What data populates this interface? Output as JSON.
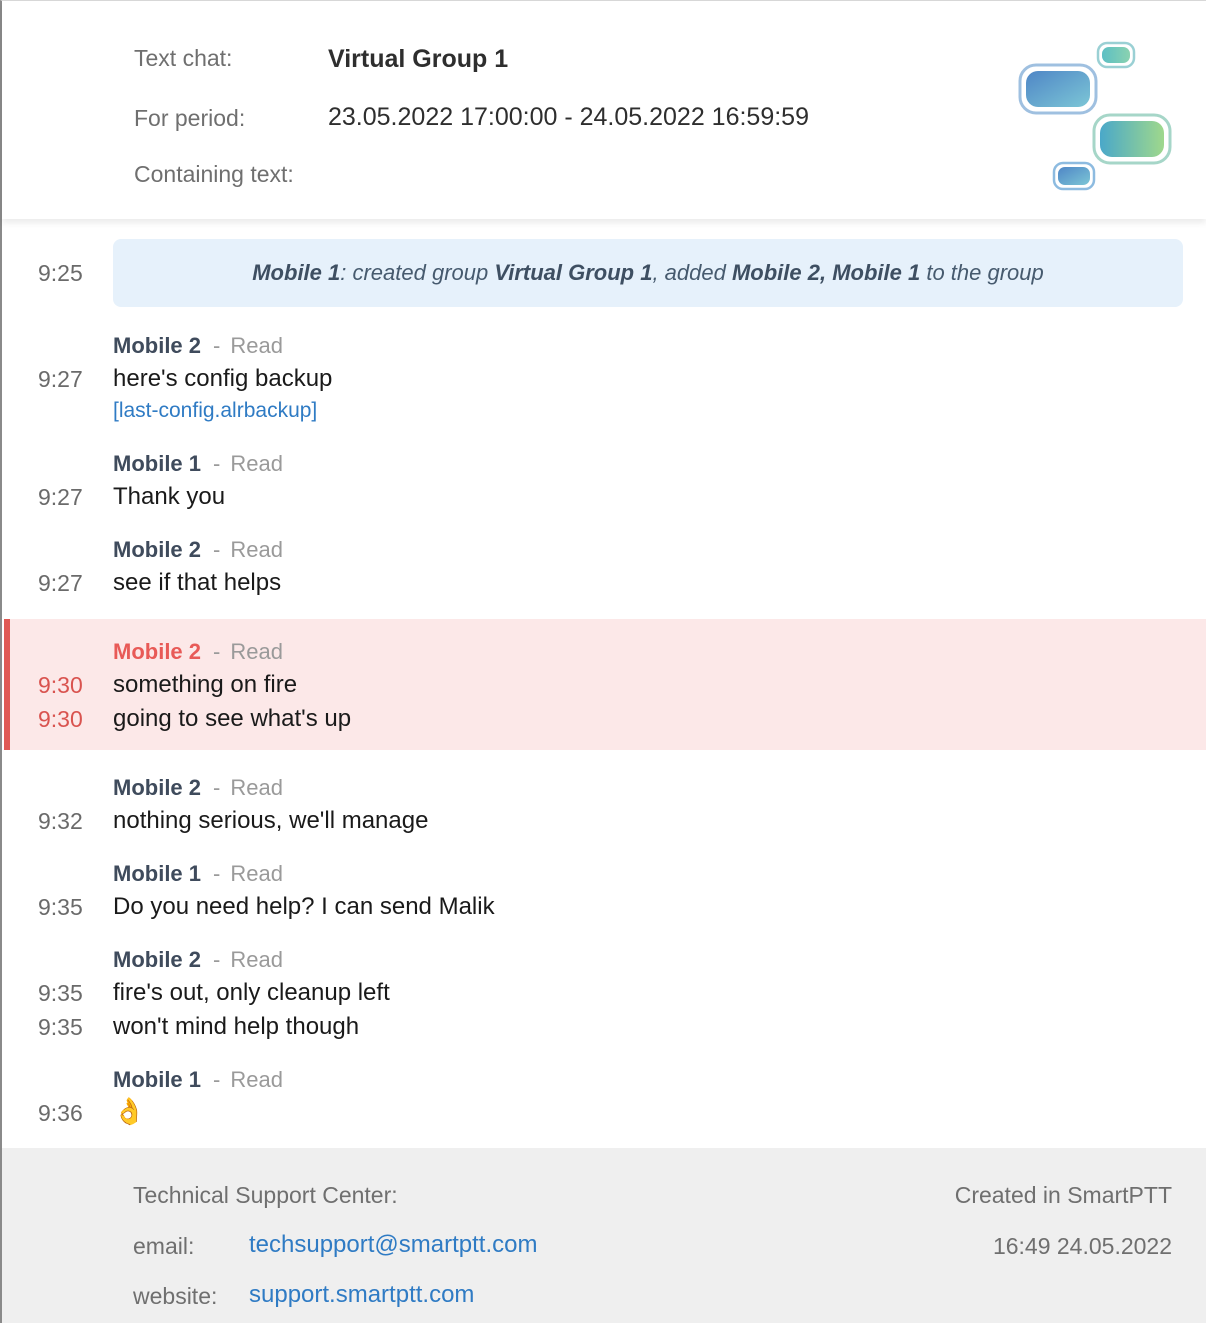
{
  "header": {
    "text_chat_label": "Text chat:",
    "text_chat_value": "Virtual Group 1",
    "period_label": "For period:",
    "period_value": "23.05.2022 17:00:00 - 24.05.2022 16:59:59",
    "containing_label": "Containing text:",
    "containing_value": ""
  },
  "system_message": {
    "time": "9:25",
    "actor": "Mobile 1",
    "text1": ": created group ",
    "group": "Virtual Group 1",
    "text2": ", added ",
    "members": "Mobile 2, Mobile 1",
    "text3": " to the group"
  },
  "messages": [
    {
      "sender": "Mobile 2",
      "status": "Read",
      "separator": "-",
      "lines": [
        {
          "time": "9:27",
          "text": "here's config backup"
        }
      ],
      "attachment": "[last-config.alrbackup]"
    },
    {
      "sender": "Mobile 1",
      "status": "Read",
      "separator": "-",
      "lines": [
        {
          "time": "9:27",
          "text": "Thank you"
        }
      ]
    },
    {
      "sender": "Mobile 2",
      "status": "Read",
      "separator": "-",
      "lines": [
        {
          "time": "9:27",
          "text": "see if that helps"
        }
      ]
    },
    {
      "sender": "Mobile 2",
      "status": "Read",
      "separator": "-",
      "alert": true,
      "lines": [
        {
          "time": "9:30",
          "text": "something on fire"
        },
        {
          "time": "9:30",
          "text": "going to see what's up"
        }
      ]
    },
    {
      "sender": "Mobile 2",
      "status": "Read",
      "separator": "-",
      "lines": [
        {
          "time": "9:32",
          "text": "nothing serious, we'll manage"
        }
      ]
    },
    {
      "sender": "Mobile 1",
      "status": "Read",
      "separator": "-",
      "lines": [
        {
          "time": "9:35",
          "text": "Do you need help? I can send Malik"
        }
      ]
    },
    {
      "sender": "Mobile 2",
      "status": "Read",
      "separator": "-",
      "lines": [
        {
          "time": "9:35",
          "text": "fire's out, only cleanup left"
        },
        {
          "time": "9:35",
          "text": "won't mind help though"
        }
      ]
    },
    {
      "sender": "Mobile 1",
      "status": "Read",
      "separator": "-",
      "lines": [
        {
          "time": "9:36",
          "text": "👌"
        }
      ]
    }
  ],
  "footer": {
    "support_title": "Technical Support Center:",
    "email_label": "email:",
    "email_value": "techsupport@smartptt.com",
    "website_label": "website:",
    "website_value": "support.smartptt.com",
    "created_in": "Created in SmartPTT",
    "created_at": "16:49 24.05.2022"
  },
  "colors": {
    "alert_bg": "#fce8e8",
    "alert_accent": "#e05a55",
    "link": "#2f7bc4",
    "system_bg": "#e6f1fb"
  },
  "icons": {
    "logo": "smartptt-logo-icon",
    "emoji": "ok-hand-icon"
  }
}
